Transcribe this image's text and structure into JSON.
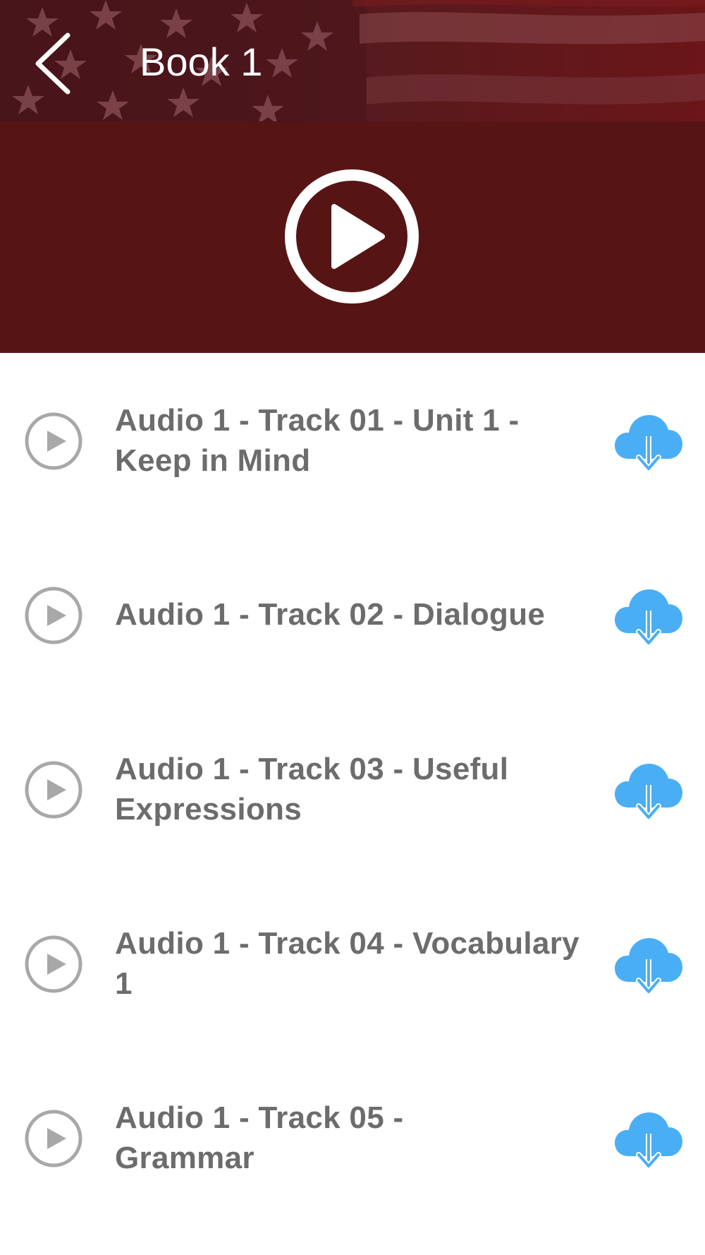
{
  "header": {
    "back_icon": "chevron-left-icon",
    "title": "Book 1",
    "background": "american-flag"
  },
  "player": {
    "play_icon": "play-circle-icon",
    "color": "#561514"
  },
  "tracks": [
    {
      "label": "Audio 1 - Track 01 - Unit 1 - Keep in Mind",
      "play_icon": "play-circle-icon",
      "download_icon": "cloud-download-icon"
    },
    {
      "label": "Audio 1 - Track 02 - Dialogue",
      "play_icon": "play-circle-icon",
      "download_icon": "cloud-download-icon"
    },
    {
      "label": "Audio 1 - Track 03 - Useful Expressions",
      "play_icon": "play-circle-icon",
      "download_icon": "cloud-download-icon"
    },
    {
      "label": "Audio 1 - Track 04 - Vocabulary 1",
      "play_icon": "play-circle-icon",
      "download_icon": "cloud-download-icon"
    },
    {
      "label": "Audio 1 - Track 05 - Grammar",
      "play_icon": "play-circle-icon",
      "download_icon": "cloud-download-icon"
    }
  ],
  "colors": {
    "accent_blue": "#4aaef5",
    "track_text": "#6c6c6c",
    "track_icon": "#a8a8a8"
  }
}
